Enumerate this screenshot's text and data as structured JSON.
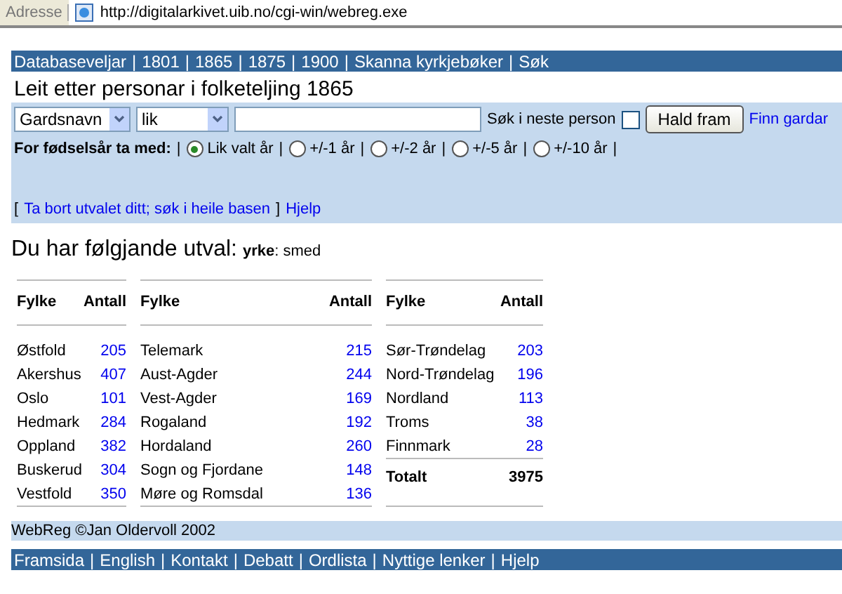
{
  "address_bar": {
    "label": "Adresse",
    "url": "http://digitalarkivet.uib.no/cgi-win/webreg.exe"
  },
  "separator": "|",
  "top_nav": [
    "Databaseveljar",
    "1801",
    "1865",
    "1875",
    "1900",
    "Skanna kyrkjebøker",
    "Søk"
  ],
  "page_title": "Leit etter personar i folketeljing 1865",
  "search": {
    "field_select": "Gardsnavn",
    "match_select": "lik",
    "next_person_label": "Søk i neste person",
    "next_person_checked": false,
    "submit": "Hald fram",
    "link": "Finn gardar"
  },
  "birth_year": {
    "label": "For fødselsår ta med:",
    "options": [
      {
        "label": "Lik valt år",
        "selected": true
      },
      {
        "label": "+/-1 år",
        "selected": false
      },
      {
        "label": "+/-2 år",
        "selected": false
      },
      {
        "label": "+/-5 år",
        "selected": false
      },
      {
        "label": "+/-10 år",
        "selected": false
      }
    ]
  },
  "links_row": {
    "open_bracket": "[",
    "link": "Ta bort utvalet ditt; søk i heile basen",
    "close_bracket": "]",
    "help": "Hjelp"
  },
  "selection": {
    "heading": "Du har følgjande utval:",
    "key": "yrke",
    "value": ": smed"
  },
  "tables": [
    {
      "columns": [
        "Fylke",
        "Antall"
      ],
      "rows": [
        [
          "Østfold",
          "205"
        ],
        [
          "Akershus",
          "407"
        ],
        [
          "Oslo",
          "101"
        ],
        [
          "Hedmark",
          "284"
        ],
        [
          "Oppland",
          "382"
        ],
        [
          "Buskerud",
          "304"
        ],
        [
          "Vestfold",
          "350"
        ]
      ]
    },
    {
      "columns": [
        "Fylke",
        "Antall"
      ],
      "rows": [
        [
          "Telemark",
          "215"
        ],
        [
          "Aust-Agder",
          "244"
        ],
        [
          "Vest-Agder",
          "169"
        ],
        [
          "Rogaland",
          "192"
        ],
        [
          "Hordaland",
          "260"
        ],
        [
          "Sogn og Fjordane",
          "148"
        ],
        [
          "Møre og Romsdal",
          "136"
        ]
      ]
    },
    {
      "columns": [
        "Fylke",
        "Antall"
      ],
      "rows": [
        [
          "Sør-Trøndelag",
          "203"
        ],
        [
          "Nord-Trøndelag",
          "196"
        ],
        [
          "Nordland",
          "113"
        ],
        [
          "Troms",
          "38"
        ],
        [
          "Finnmark",
          "28"
        ]
      ],
      "total": [
        "Totalt",
        "3975"
      ]
    }
  ],
  "footer": {
    "credit": "WebReg ©Jan Oldervoll 2002",
    "nav": [
      "Framsida",
      "English",
      "Kontakt",
      "Debatt",
      "Ordlista",
      "Nyttige lenker",
      "Hjelp"
    ]
  }
}
